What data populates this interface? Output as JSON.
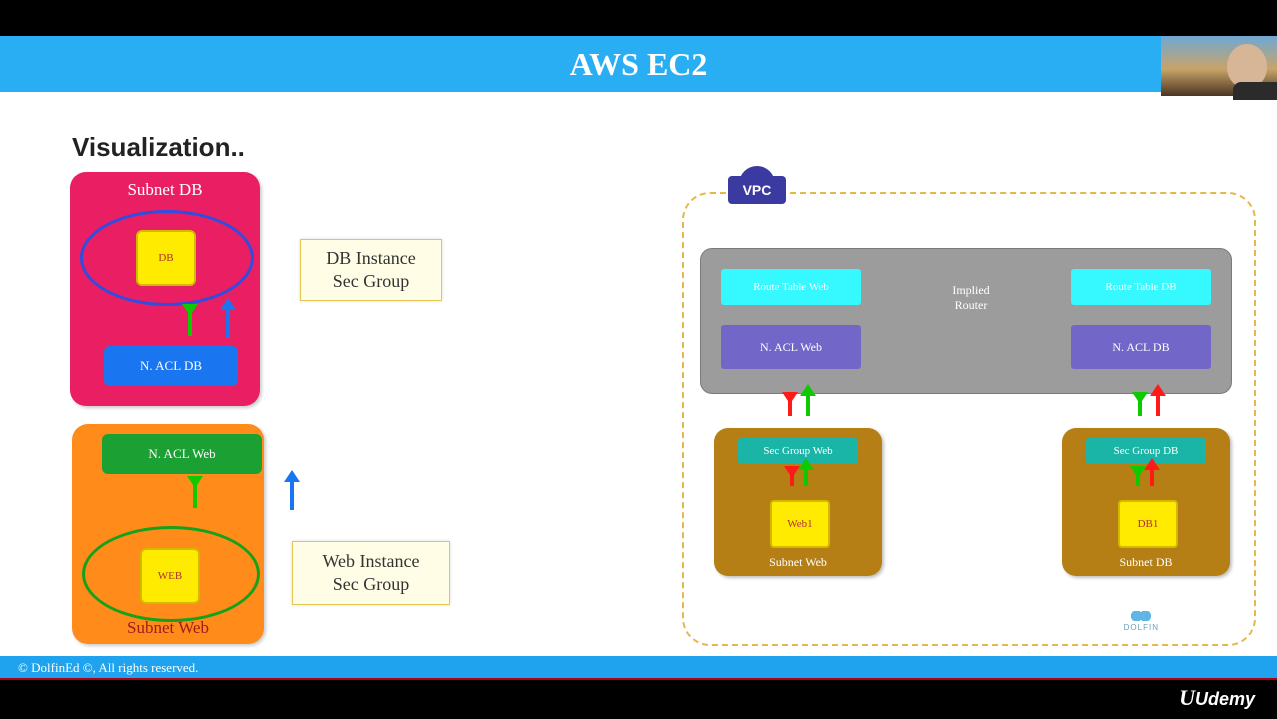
{
  "title": "AWS EC2",
  "subtitle": "Visualization..",
  "left": {
    "subnet_db": {
      "header": "Subnet DB",
      "db_label": "DB",
      "nacl_label": "N. ACL DB"
    },
    "subnet_web": {
      "nacl_label": "N. ACL Web",
      "web_label": "WEB",
      "footer": "Subnet Web"
    },
    "secgrp_db": "DB Instance\nSec Group",
    "secgrp_web": "Web Instance\nSec Group"
  },
  "right": {
    "vpc_tag": "VPC",
    "router": {
      "implied": "Implied\nRouter",
      "rt_web": "Route Table Web",
      "rt_db": "Route Table DB",
      "nacl_web": "N. ACL Web",
      "nacl_db": "N. ACL DB"
    },
    "subnet_web": {
      "sg": "Sec Group Web",
      "inst": "Web1",
      "name": "Subnet Web"
    },
    "subnet_db": {
      "sg": "Sec Group DB",
      "inst": "DB1",
      "name": "Subnet DB"
    }
  },
  "footer": "© DolfinEd ©, All rights reserved.",
  "brand": "Udemy",
  "watermark": "DOLFIN"
}
